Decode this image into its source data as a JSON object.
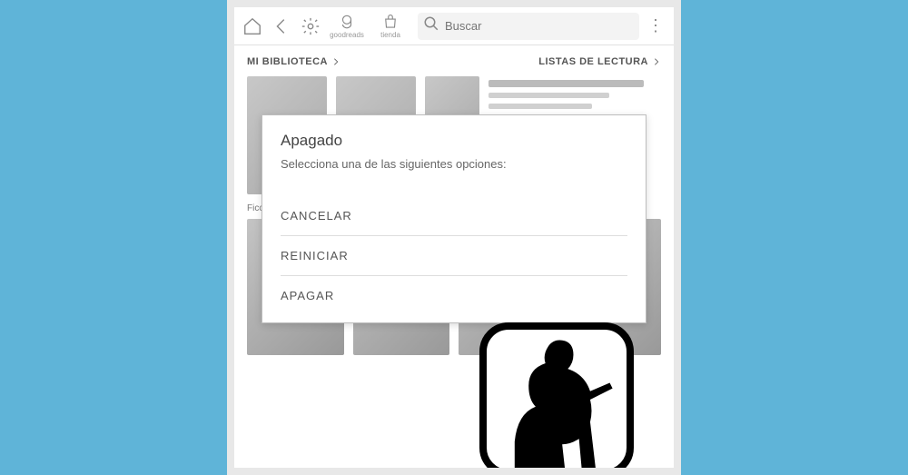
{
  "toolbar": {
    "goodreads_label": "goodreads",
    "store_label": "tienda",
    "search_placeholder": "Buscar"
  },
  "sections": {
    "library": "MI BIBLIOTECA",
    "reading_lists": "LISTAS DE LECTURA",
    "fiction_prefix": "Ficc"
  },
  "modal": {
    "title": "Apagado",
    "subtitle": "Selecciona una de las siguientes opciones:",
    "cancel": "CANCELAR",
    "restart": "REINICIAR",
    "shutdown": "APAGAR"
  }
}
